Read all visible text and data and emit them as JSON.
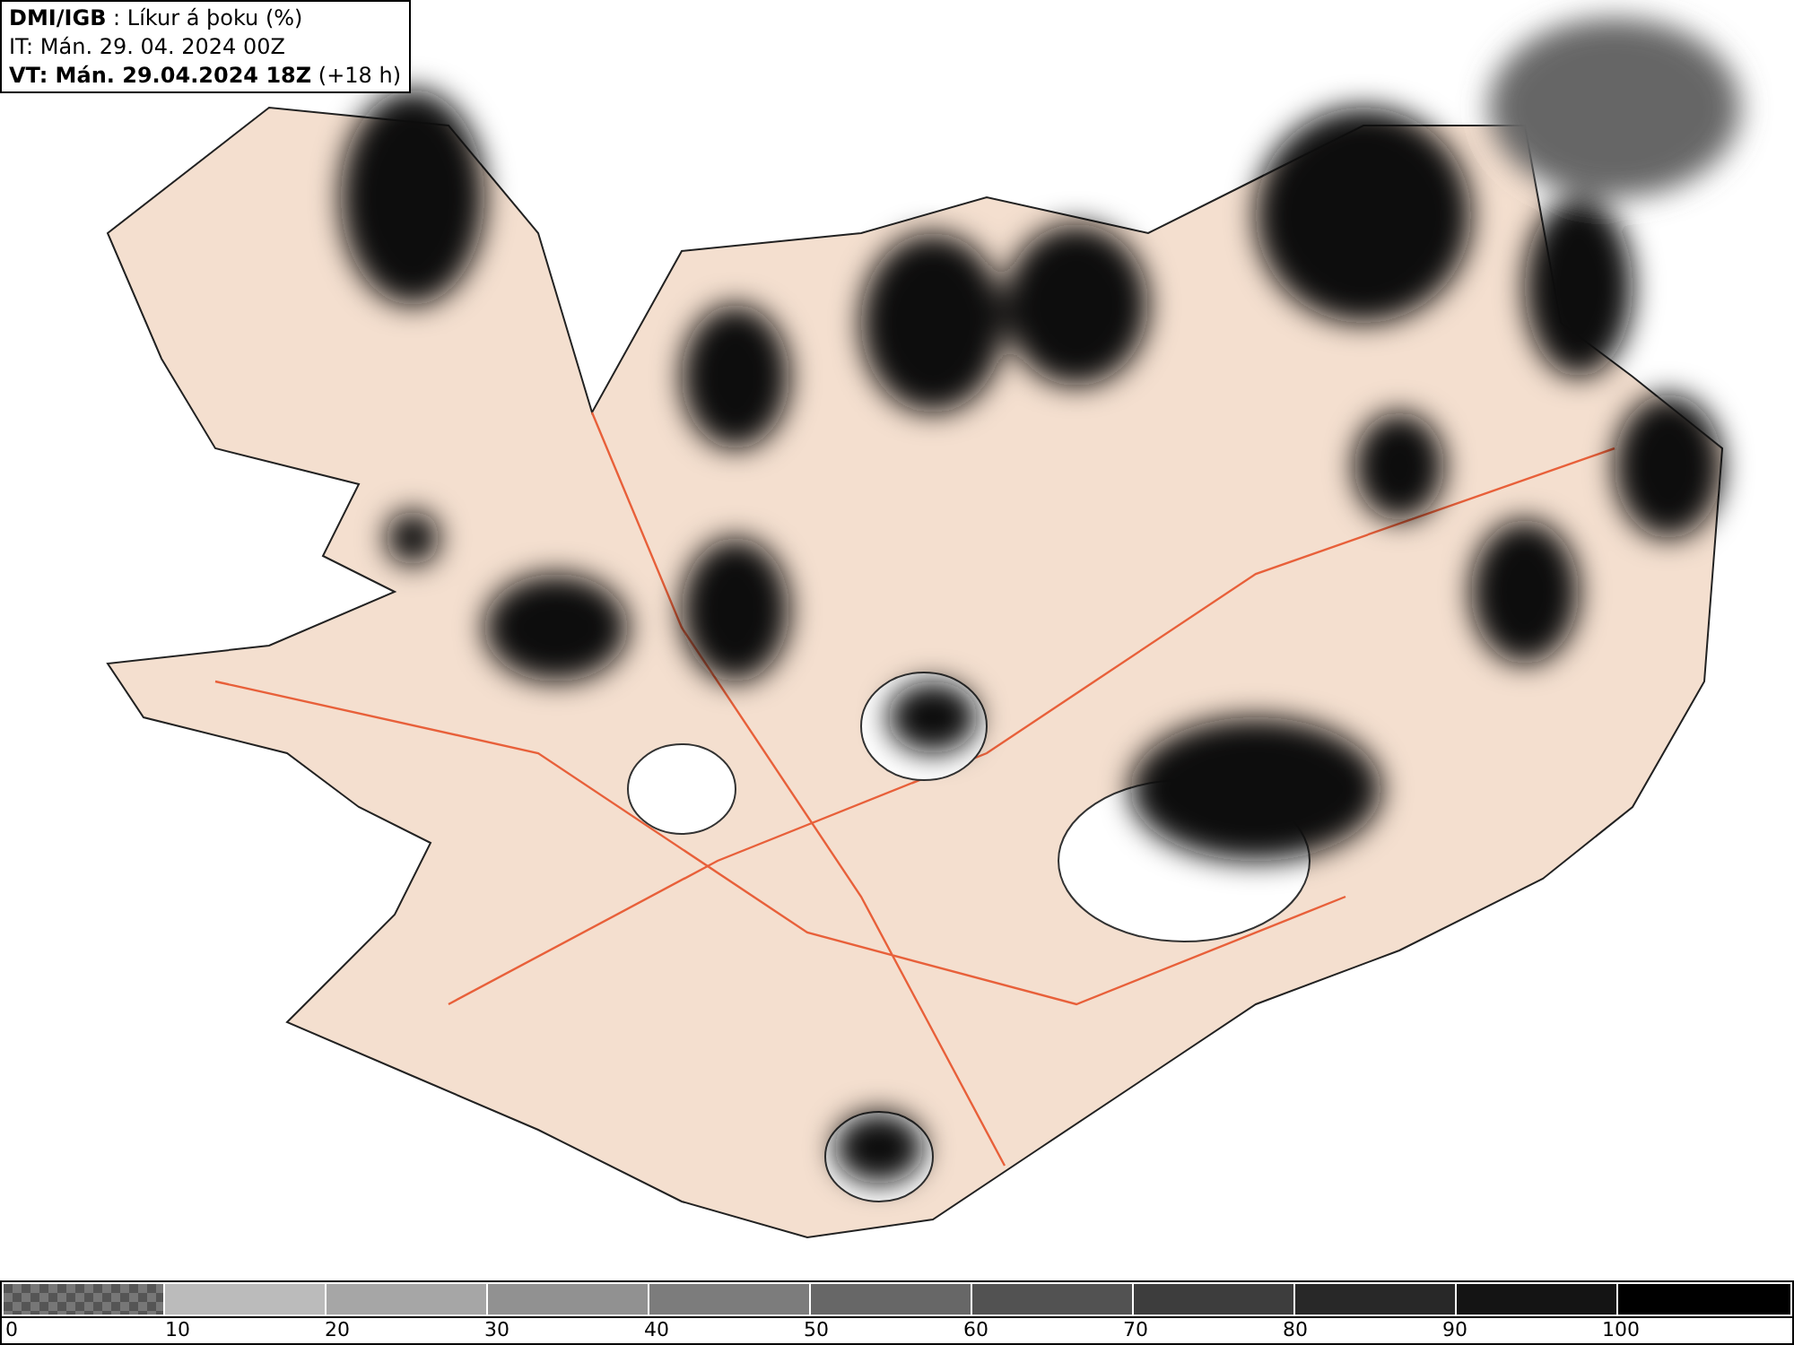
{
  "header": {
    "lines": [
      "**DMI/IGB** : Líkur á þoku (%)",
      "IT: Mán. 29. 04. 2024 00Z",
      "**VT: Mán. 29.04.2024 18Z** (+18 h)"
    ]
  },
  "legend": {
    "segments": [
      {
        "label": "0",
        "color": "#777777",
        "kind": "checkered"
      },
      {
        "label": "10",
        "color": "#bbbbbb",
        "kind": "solid"
      },
      {
        "label": "20",
        "color": "#a6a6a6",
        "kind": "solid"
      },
      {
        "label": "30",
        "color": "#919191",
        "kind": "solid"
      },
      {
        "label": "40",
        "color": "#7c7c7c",
        "kind": "solid"
      },
      {
        "label": "50",
        "color": "#676767",
        "kind": "solid"
      },
      {
        "label": "60",
        "color": "#525252",
        "kind": "solid"
      },
      {
        "label": "70",
        "color": "#3d3d3d",
        "kind": "solid"
      },
      {
        "label": "80",
        "color": "#282828",
        "kind": "solid"
      },
      {
        "label": "90",
        "color": "#141414",
        "kind": "solid"
      },
      {
        "label": "100",
        "color": "#000000",
        "kind": "solid"
      }
    ]
  }
}
